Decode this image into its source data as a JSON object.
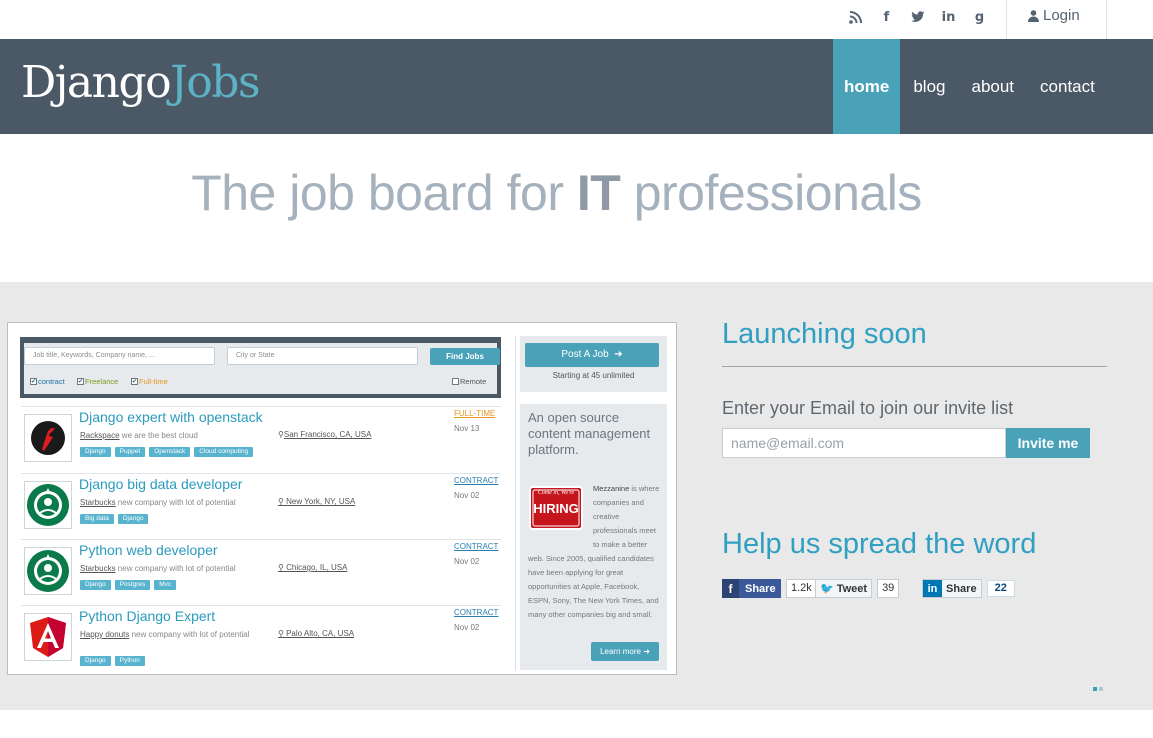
{
  "topbar": {
    "social_icons": [
      "rss-icon",
      "facebook-icon",
      "twitter-icon",
      "linkedin-icon",
      "google-plus-icon"
    ],
    "social_glyphs": [
      "⦿",
      "f",
      "t",
      "in",
      "g"
    ],
    "login_label": "Login"
  },
  "navbar": {
    "brand_part1": "Django",
    "brand_part2": "Jobs",
    "items": [
      {
        "label": "home",
        "active": true
      },
      {
        "label": "blog",
        "active": false
      },
      {
        "label": "about",
        "active": false
      },
      {
        "label": "contact",
        "active": false
      }
    ]
  },
  "hero": {
    "title_pre": "The job board for ",
    "title_bold": "IT",
    "title_post": " professionals"
  },
  "screenshot": {
    "search": {
      "keywords_placeholder": "Job title, Keywords, Company name, ...",
      "city_placeholder": "City or State",
      "find_label": "Find Jobs",
      "filters": [
        {
          "label": "contract",
          "checked": true,
          "color": "#1a6fa5"
        },
        {
          "label": "Freelance",
          "checked": true,
          "color": "#7a9a1e"
        },
        {
          "label": "Full-time",
          "checked": true,
          "color": "#e6961e"
        }
      ],
      "remote_label": "Remote"
    },
    "jobs": [
      {
        "title": "Django expert with openstack",
        "company": "Rackspace",
        "company_desc": " we are the best cloud",
        "location": "San Francisco, CA, USA",
        "type": "FULL-TIME",
        "date": "Nov 13",
        "tags": [
          "Django",
          "Puppet",
          "Openstack",
          "Cloud computing"
        ]
      },
      {
        "title": "Django big data developer",
        "company": "Starbucks",
        "company_desc": " new company with lot of potential",
        "location": "New York, NY, USA",
        "type": "CONTRACT",
        "date": "Nov 02",
        "tags": [
          "Big data",
          "Django"
        ]
      },
      {
        "title": "Python web developer",
        "company": "Starbucks",
        "company_desc": " new company with lot of potential",
        "location": "Chicago, IL, USA",
        "type": "CONTRACT",
        "date": "Nov 02",
        "tags": [
          "Django",
          "Postgres",
          "Mvc"
        ]
      },
      {
        "title": "Python Django Expert",
        "company": "Happy donuts",
        "company_desc": " new company with lot of potential",
        "location": "Palo Alto, CA, USA",
        "type": "CONTRACT",
        "date": "Nov 02",
        "tags": [
          "Django",
          "Python"
        ]
      }
    ],
    "post": {
      "label": "Post A Job",
      "subtitle": "Starting at 45 unlimited"
    },
    "ad": {
      "title": "An open source content management platform.",
      "logo_text_top": "Come in, We're",
      "logo_text_bottom": "HIRING",
      "brand": "Mezzanine",
      "body": " is where companies and creative professionals meet to make a better web. Since 2005, qualified candidates have been applying for great opportunities at Apple, Facebook, ESPN, Sony, The New York Times, and many other companies big and small.",
      "learn_label": "Learn more"
    }
  },
  "launch": {
    "title": "Launching soon",
    "invite_label": "Enter your Email to join our invite list",
    "email_placeholder": "name@email.com",
    "invite_button": "Invite me"
  },
  "spread": {
    "title": "Help us spread the word",
    "facebook_label": "Share",
    "facebook_count": "1.2k",
    "twitter_label": "Tweet",
    "twitter_count": "39",
    "linkedin_label": "Share",
    "linkedin_count": "22"
  },
  "colors": {
    "navbar_bg": "#4b5866",
    "accent": "#4aa2b9",
    "heading_blue": "#2fa0c2"
  }
}
